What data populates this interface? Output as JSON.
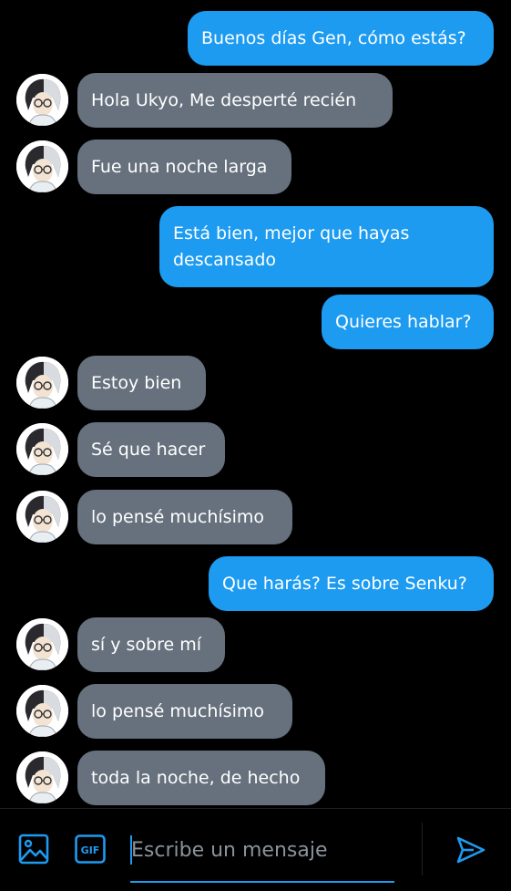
{
  "messages": [
    {
      "from": "me",
      "text": "Buenos días Gen, cómo estás?"
    },
    {
      "from": "them",
      "text": "Hola Ukyo, Me desperté recién"
    },
    {
      "from": "them",
      "text": "Fue una noche larga"
    },
    {
      "from": "me",
      "text": "Está bien, mejor que hayas descansado"
    },
    {
      "from": "me",
      "text": "Quieres hablar?"
    },
    {
      "from": "them",
      "text": "Estoy bien"
    },
    {
      "from": "them",
      "text": "Sé que hacer"
    },
    {
      "from": "them",
      "text": "lo pensé muchísimo"
    },
    {
      "from": "me",
      "text": "Que harás? Es sobre Senku?"
    },
    {
      "from": "them",
      "text": "sí y sobre mí"
    },
    {
      "from": "them",
      "text": "lo pensé muchísimo"
    },
    {
      "from": "them",
      "text": "toda la noche, de hecho"
    }
  ],
  "composer": {
    "placeholder": "Escribe un mensaje",
    "gif_label": "GIF",
    "media_icon": "image-icon",
    "send_icon": "send-icon"
  },
  "colors": {
    "background": "#000000",
    "sent_bubble": "#1d9bf0",
    "received_bubble": "#66717d",
    "accent": "#1d9bf0"
  }
}
